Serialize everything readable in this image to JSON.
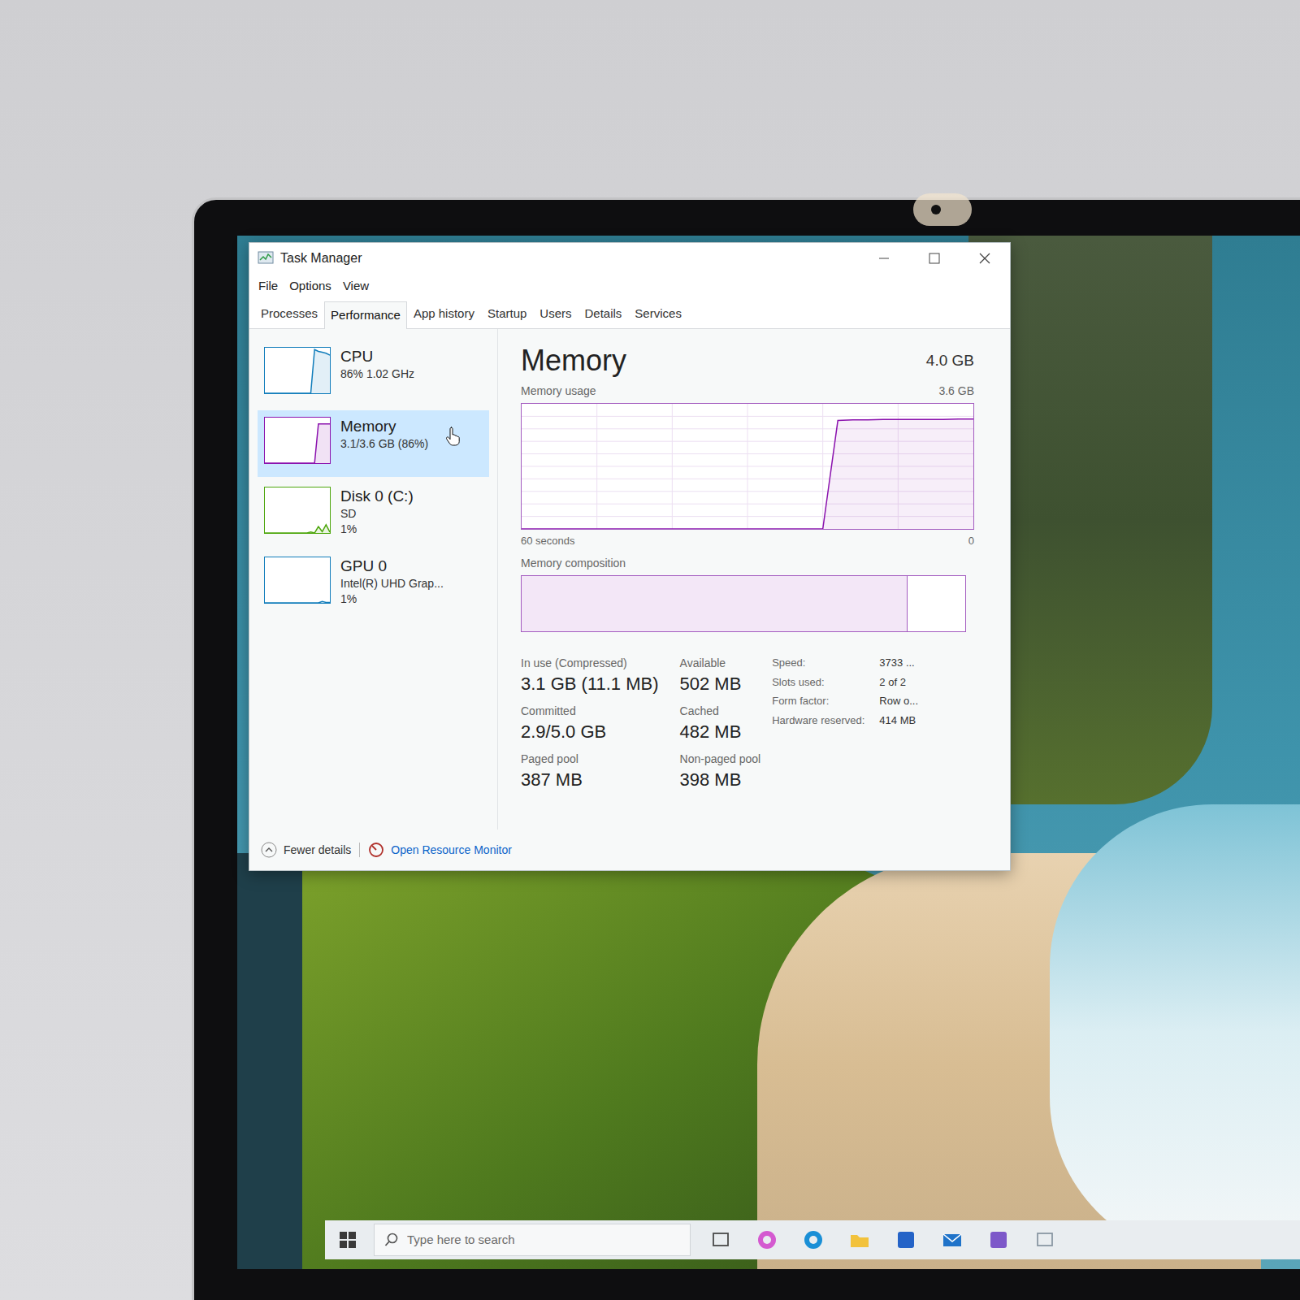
{
  "window": {
    "title": "Task Manager"
  },
  "menu": [
    "File",
    "Options",
    "View"
  ],
  "tabs": [
    {
      "label": "Processes",
      "selected": false
    },
    {
      "label": "Performance",
      "selected": true
    },
    {
      "label": "App history",
      "selected": false
    },
    {
      "label": "Startup",
      "selected": false
    },
    {
      "label": "Users",
      "selected": false
    },
    {
      "label": "Details",
      "selected": false
    },
    {
      "label": "Services",
      "selected": false
    }
  ],
  "sidebar": {
    "items": [
      {
        "name": "CPU",
        "lines": [
          "86% 1.02 GHz"
        ],
        "selected": false,
        "color": "#117dbb",
        "values": [
          0,
          0,
          0,
          0,
          0,
          0,
          0,
          0,
          0,
          0,
          0,
          0,
          0,
          96,
          92,
          90,
          88,
          84
        ]
      },
      {
        "name": "Memory",
        "lines": [
          "3.1/3.6 GB (86%)"
        ],
        "selected": true,
        "color": "#8b12ae",
        "values": [
          0,
          0,
          0,
          0,
          0,
          0,
          0,
          0,
          0,
          0,
          0,
          0,
          0,
          0,
          86,
          86,
          86,
          86
        ]
      },
      {
        "name": "Disk 0 (C:)",
        "lines": [
          "SD",
          "1%"
        ],
        "selected": false,
        "color": "#4da60c",
        "values": [
          0,
          0,
          0,
          0,
          0,
          0,
          0,
          0,
          0,
          0,
          0,
          0,
          2,
          0,
          14,
          3,
          18,
          2
        ]
      },
      {
        "name": "GPU 0",
        "lines": [
          "Intel(R) UHD Grap...",
          "1%"
        ],
        "selected": false,
        "color": "#117dbb",
        "values": [
          0,
          0,
          0,
          0,
          0,
          0,
          0,
          0,
          0,
          0,
          0,
          0,
          0,
          0,
          0,
          3,
          1,
          1
        ]
      }
    ]
  },
  "memory": {
    "title": "Memory",
    "total": "4.0 GB",
    "usage_label": "Memory usage",
    "usage_max": "3.6 GB",
    "time_label": "60 seconds",
    "min_label": "0",
    "usage_values": [
      0,
      0,
      0,
      0,
      0,
      0,
      0,
      0,
      0,
      0,
      0,
      0,
      0,
      0,
      0,
      0,
      0,
      0,
      0,
      0,
      0,
      3.12,
      3.14,
      3.14,
      3.15,
      3.15,
      3.15,
      3.15,
      3.15,
      3.16,
      3.16
    ],
    "composition_label": "Memory composition",
    "composition_level": 0.87,
    "stats": [
      {
        "label": "In use (Compressed)",
        "value": "3.1 GB (11.1 MB)"
      },
      {
        "label": "Available",
        "value": "502 MB"
      },
      {
        "label": "Committed",
        "value": "2.9/5.0 GB"
      },
      {
        "label": "Cached",
        "value": "482 MB"
      },
      {
        "label": "Paged pool",
        "value": "387 MB"
      },
      {
        "label": "Non-paged pool",
        "value": "398 MB"
      }
    ],
    "details": [
      {
        "label": "Speed:",
        "value": "3733 ..."
      },
      {
        "label": "Slots used:",
        "value": "2 of 2"
      },
      {
        "label": "Form factor:",
        "value": "Row o..."
      },
      {
        "label": "Hardware reserved:",
        "value": "414 MB"
      }
    ]
  },
  "footer": {
    "fewer_details": "Fewer details",
    "resource_monitor": "Open Resource Monitor"
  },
  "taskbar": {
    "search_placeholder": "Type here to search"
  }
}
